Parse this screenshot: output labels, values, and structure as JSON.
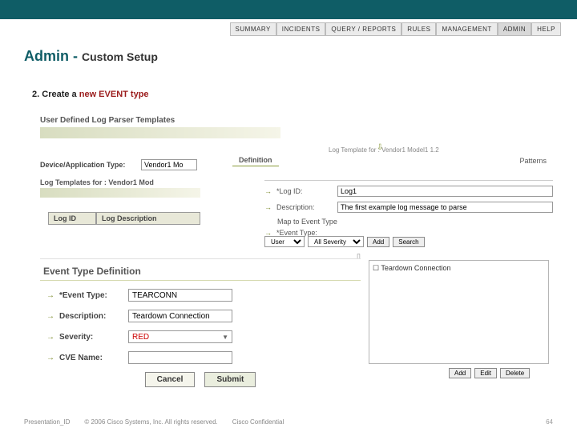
{
  "nav": [
    "SUMMARY",
    "INCIDENTS",
    "QUERY / REPORTS",
    "RULES",
    "MANAGEMENT",
    "ADMIN",
    "HELP"
  ],
  "active_nav": "ADMIN",
  "title": {
    "main": "Admin",
    "dash": " - ",
    "sub": "Custom Setup"
  },
  "step": {
    "num": "2.",
    "text": "Create a ",
    "highlight": "new EVENT type"
  },
  "bg": {
    "section1": "User Defined Log Parser Templates",
    "device_label": "Device/Application Type:",
    "device_value": "Vendor1 Mo",
    "log_templates_label": "Log Templates for : Vendor1 Mod",
    "top_caption": "Log Template for : Vendor1 Model1 1.2",
    "tabs": [
      "Definition",
      "Patterns"
    ],
    "logid_label": "*Log ID:",
    "logid_value": "Log1",
    "desc_label": "Description:",
    "desc_value": "The first example log message to parse",
    "map_label": "Map to Event Type",
    "eventtype_label": "*Event Type:",
    "table": {
      "c1": "Log ID",
      "c2": "Log Description"
    },
    "filters": {
      "user": "User",
      "sev": "All Severity",
      "add": "Add",
      "search": "Search"
    },
    "event_row": "Teardown Connection",
    "actions": [
      "Add",
      "Edit",
      "Delete"
    ]
  },
  "def": {
    "header": "Event Type Definition",
    "rows": [
      {
        "label": "*Event Type:",
        "value": "TEARCONN",
        "red": false
      },
      {
        "label": "Description:",
        "value": "Teardown Connection",
        "red": false
      },
      {
        "label": "Severity:",
        "value": "RED",
        "red": true,
        "select": true
      },
      {
        "label": "CVE Name:",
        "value": "",
        "red": false
      }
    ],
    "cancel": "Cancel",
    "submit": "Submit"
  },
  "footer": {
    "pres": "Presentation_ID",
    "copy": "© 2006 Cisco Systems, Inc. All rights reserved.",
    "conf": "Cisco Confidential",
    "page": "64"
  }
}
